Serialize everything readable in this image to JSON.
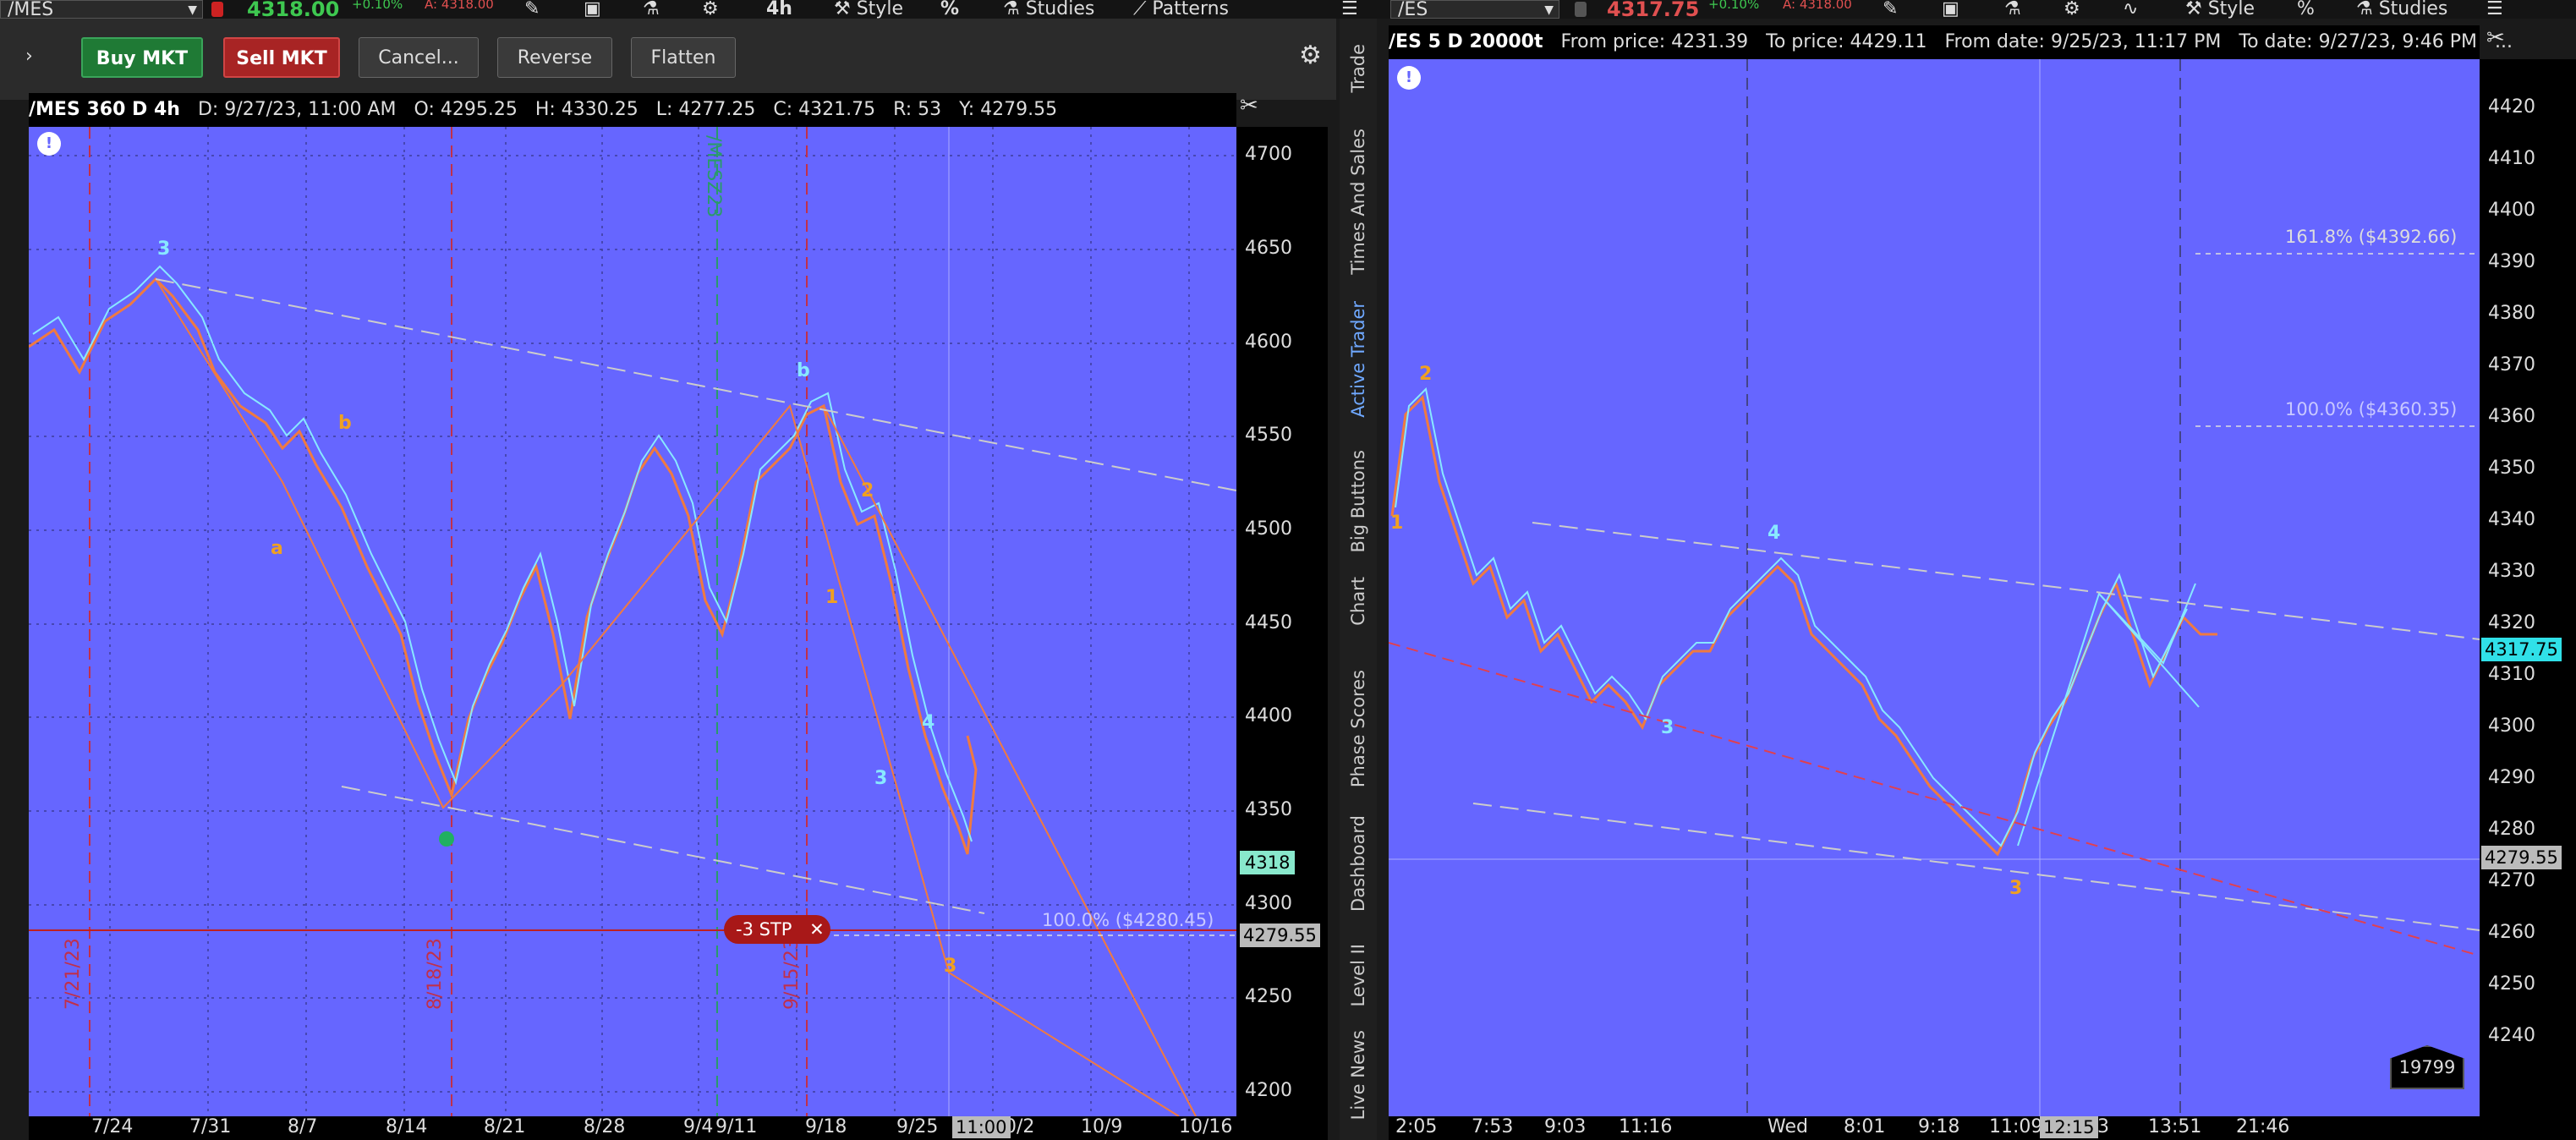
{
  "left_window": {
    "symbol": "/MES",
    "price": "4318.00",
    "change": "+0.10%",
    "ask": "A: 4318.00",
    "aggregation": "4h",
    "style_label": "Style",
    "studies_label": "Studies",
    "patterns_label": "Patterns",
    "pct_label": "%"
  },
  "right_window": {
    "symbol": "/ES",
    "price": "4317.75",
    "change": "+0.10%",
    "ask": "A: 4318.00",
    "style_label": "Style",
    "studies_label": "Studies"
  },
  "trade_bar": {
    "buy": "Buy MKT",
    "sell": "Sell MKT",
    "cancel": "Cancel...",
    "reverse": "Reverse",
    "flatten": "Flatten"
  },
  "left_chart": {
    "title": "/MES 360 D 4h",
    "date": "D: 9/27/23, 11:00 AM",
    "open": "O: 4295.25",
    "high": "H: 4330.25",
    "low": "L: 4277.25",
    "close": "C: 4321.75",
    "range": "R: 53",
    "y": "Y: 4279.55",
    "price_ticks": [
      "4700",
      "4650",
      "4600",
      "4550",
      "4500",
      "4450",
      "4400",
      "4350",
      "4300",
      "4250",
      "4200"
    ],
    "date_ticks": [
      "7/24",
      "7/31",
      "8/7",
      "8/14",
      "8/21",
      "8/28",
      "9/4",
      "9/11",
      "9/18",
      "9/25",
      "0/2",
      "10/9",
      "10/16"
    ],
    "cursor_time": "11:00",
    "current_price_label": "4318",
    "crosshair_price_label": "4279.55",
    "order_label": "-3 STP",
    "order_close": "✕",
    "fib_label": "100.0%  ($4280.45)",
    "vertical_labels": [
      "7/21/23",
      "8/18/23",
      "9/15/23",
      "/MESZ23"
    ],
    "wave_labels": [
      "3",
      "b",
      "a",
      "b",
      "2",
      "1",
      "4",
      "3",
      "3"
    ]
  },
  "right_chart": {
    "title": "/ES 5 D 20000t",
    "from_price": "From price: 4231.39",
    "to_price": "To price: 4429.11",
    "from_date": "From date: 9/25/23, 11:17 PM",
    "to_date": "To date: 9/27/23, 9:46 PM",
    "ellipsis": "...",
    "price_ticks": [
      "4420",
      "4410",
      "4400",
      "4390",
      "4380",
      "4370",
      "4360",
      "4350",
      "4340",
      "4330",
      "4320",
      "4310",
      "4300",
      "4290",
      "4280",
      "4270",
      "4260",
      "4250",
      "4240"
    ],
    "time_ticks": [
      "2:05",
      "7:53",
      "9:03",
      "11:16",
      "Wed",
      "8:01",
      "9:18",
      "11:09",
      "43",
      "13:51",
      "21:46"
    ],
    "cursor_time": "12:15",
    "current_price_label": "4317.75",
    "crosshair_price_label": "4279.55",
    "fib_1618": "161.8%  ($4392.66)",
    "fib_100": "100.0%  ($4360.35)",
    "tick_count": "19799",
    "wave_labels": [
      "2",
      "1",
      "4",
      "3",
      "3"
    ]
  },
  "side_tabs": [
    "Trade",
    "Times And Sales",
    "Active Trader",
    "Big Buttons",
    "Chart",
    "Phase Scores",
    "Dashboard",
    "Level II",
    "Live News"
  ],
  "colors": {
    "chart_bg": "#6666ff",
    "wave_orange": "#f0a020",
    "wave_cyan": "#88e8ff",
    "buy_green": "#1f7a35",
    "sell_red": "#a82424"
  }
}
